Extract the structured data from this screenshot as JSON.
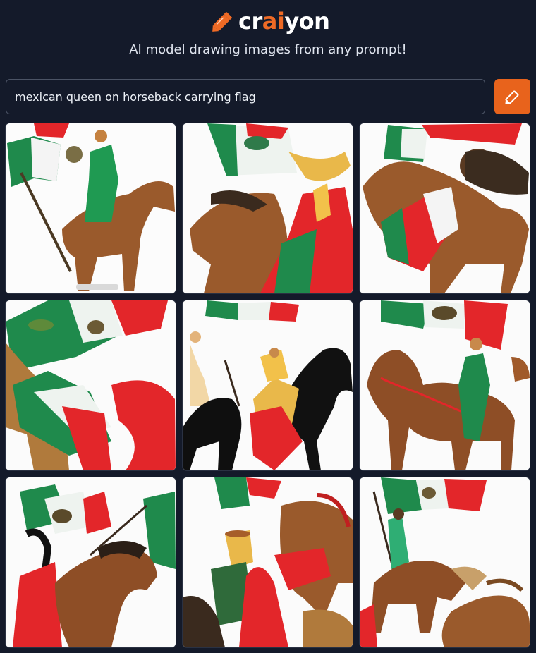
{
  "header": {
    "logo_parts": [
      "cr",
      "ai",
      "yon"
    ],
    "tagline": "AI model drawing images from any prompt!"
  },
  "search": {
    "value": "mexican queen on horseback carrying flag"
  },
  "colors": {
    "background": "#141a2a",
    "accent": "#e8631c",
    "flag_green": "#1f8a4c",
    "flag_red": "#e3262a",
    "horse_brown": "#9a5a2c"
  },
  "icons": {
    "logo": "pencil-icon",
    "draw_button": "pencil-icon"
  },
  "results": {
    "count": 9,
    "items": [
      "generated-image-1",
      "generated-image-2",
      "generated-image-3",
      "generated-image-4",
      "generated-image-5",
      "generated-image-6",
      "generated-image-7",
      "generated-image-8",
      "generated-image-9"
    ]
  }
}
